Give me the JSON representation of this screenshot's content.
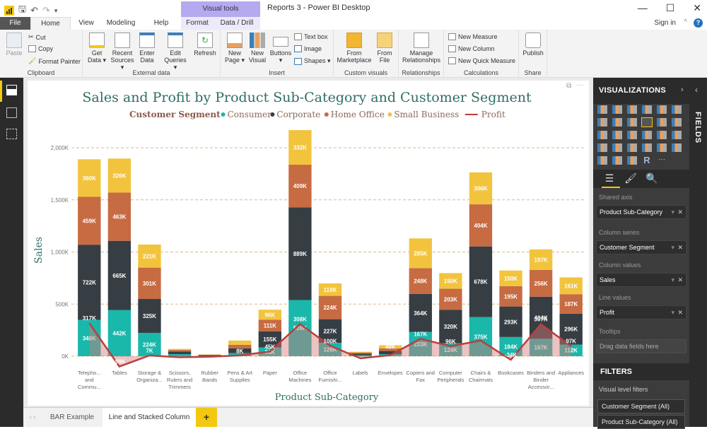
{
  "app": {
    "title": "Reports 3 - Power BI Desktop",
    "contextual_tab_group": "Visual tools",
    "sign_in": "Sign in"
  },
  "tabs": [
    {
      "label": "File"
    },
    {
      "label": "Home"
    },
    {
      "label": "View"
    },
    {
      "label": "Modeling"
    },
    {
      "label": "Help"
    },
    {
      "label": "Format"
    },
    {
      "label": "Data / Drill"
    }
  ],
  "ribbon": {
    "clipboard": {
      "label": "Clipboard",
      "paste": "Paste",
      "cut": "Cut",
      "copy": "Copy",
      "format_painter": "Format Painter"
    },
    "external_data": {
      "label": "External data",
      "get_data": "Get Data ▾",
      "recent_sources": "Recent Sources ▾",
      "enter_data": "Enter Data",
      "edit_queries": "Edit Queries ▾",
      "refresh": "Refresh"
    },
    "insert": {
      "label": "Insert",
      "new_page": "New Page ▾",
      "new_visual": "New Visual",
      "buttons": "Buttons ▾",
      "text_box": "Text box",
      "image": "Image",
      "shapes": "Shapes ▾"
    },
    "custom_visuals": {
      "label": "Custom visuals",
      "from_marketplace": "From Marketplace",
      "from_file": "From File"
    },
    "relationships": {
      "label": "Relationships",
      "manage": "Manage Relationships"
    },
    "calculations": {
      "label": "Calculations",
      "new_measure": "New Measure",
      "new_column": "New Column",
      "new_quick_measure": "New Quick Measure"
    },
    "share": {
      "label": "Share",
      "publish": "Publish"
    }
  },
  "page_tabs": [
    {
      "label": "BAR Example"
    },
    {
      "label": "Line and Stacked Column"
    },
    {
      "label": "+"
    }
  ],
  "visualizations_pane": {
    "title": "VISUALIZATIONS",
    "wells": [
      {
        "label": "Shared axis",
        "field": "Product Sub-Category"
      },
      {
        "label": "Column series",
        "field": "Customer Segment"
      },
      {
        "label": "Column values",
        "field": "Sales"
      },
      {
        "label": "Line values",
        "field": "Profit"
      },
      {
        "label": "Tooltips",
        "placeholder": "Drag data fields here"
      }
    ],
    "filters_title": "FILTERS",
    "visual_level_filters": "Visual level filters",
    "filters": [
      "Customer Segment (All)",
      "Product Sub-Category (All)"
    ]
  },
  "fields_pane": {
    "title": "FIELDS"
  },
  "colors": {
    "consumer": "#1ab7ab",
    "corporate": "#363e44",
    "home_office": "#c76b43",
    "small_business": "#f2c43d",
    "profit_line": "#b9403d",
    "title": "#2f6e64",
    "accent": "#f2c811"
  },
  "chart_data": {
    "type": "bar",
    "subtype": "stacked-column-with-line",
    "title": "Sales and Profit by Product Sub-Category and Customer Segment",
    "legend_title": "Customer Segment",
    "legend_position": "top",
    "xlabel": "Product Sub-Category",
    "ylabel": "Sales",
    "ylim": [
      0,
      2200
    ],
    "yunit": "K",
    "yticks": [
      "0K",
      "500K",
      "1,000K",
      "1,500K",
      "2,000K"
    ],
    "ytick_values": [
      0,
      500,
      1000,
      1500,
      2000
    ],
    "grid": true,
    "categories": [
      "Telepho... and Commu...",
      "Tables",
      "Storage & Organiza...",
      "Scissors, Rulers and Trimmers",
      "Rubber Bands",
      "Pens & Art Supplies",
      "Paper",
      "Office Machines",
      "Office Furnishi...",
      "Labels",
      "Envelopes",
      "Copiers and Fax",
      "Computer Peripherals",
      "Chairs & Chairmats",
      "Bookcases",
      "Binders and Binder Accessor...",
      "Appliances"
    ],
    "series": [
      {
        "name": "Consumer",
        "values": [
          348,
          442,
          224,
          20,
          4,
          30,
          84,
          539,
          128,
          10,
          20,
          233,
          124,
          375,
          184,
          167,
          112
        ],
        "labels": [
          "348K",
          "442K",
          "224K",
          "",
          "",
          "",
          "84K",
          "539K",
          "128K",
          "",
          "",
          "233K",
          "124K",
          "375K",
          "184K",
          "167K",
          "112K"
        ]
      },
      {
        "name": "Corporate",
        "values": [
          722,
          665,
          325,
          25,
          6,
          45,
          155,
          889,
          227,
          15,
          30,
          364,
          320,
          678,
          293,
          404,
          296
        ],
        "labels": [
          "722K",
          "665K",
          "325K",
          "",
          "",
          "8K",
          "155K",
          "889K",
          "227K",
          "",
          "",
          "364K",
          "320K",
          "678K",
          "293K",
          "404K",
          "296K"
        ]
      },
      {
        "name": "Home Office",
        "values": [
          459,
          463,
          301,
          15,
          4,
          35,
          111,
          409,
          224,
          10,
          25,
          248,
          203,
          404,
          195,
          256,
          187
        ],
        "labels": [
          "459K",
          "463K",
          "301K",
          "",
          "",
          "",
          "111K",
          "409K",
          "224K",
          "",
          "",
          "248K",
          "203K",
          "404K",
          "195K",
          "256K",
          "187K"
        ]
      },
      {
        "name": "Small Business",
        "values": [
          360,
          326,
          221,
          10,
          3,
          40,
          96,
          332,
          119,
          8,
          30,
          285,
          150,
          306,
          150,
          197,
          161
        ],
        "labels": [
          "360K",
          "326K",
          "221K",
          "",
          "",
          "",
          "96K",
          "332K",
          "119K",
          "",
          "48K",
          "285K",
          "150K",
          "306K",
          "150K",
          "197K",
          "161K"
        ]
      }
    ],
    "line": {
      "name": "Profit",
      "values": [
        317,
        -99,
        7,
        -10,
        -5,
        8,
        45,
        308,
        100,
        -20,
        10,
        167,
        96,
        150,
        -34,
        307,
        97
      ],
      "labels": [
        "317K",
        "-99K",
        "7K",
        "",
        "",
        "",
        "45K",
        "308K",
        "100K",
        "",
        "",
        "167K",
        "96K",
        "",
        "-34K",
        "307K",
        "97K"
      ]
    }
  }
}
